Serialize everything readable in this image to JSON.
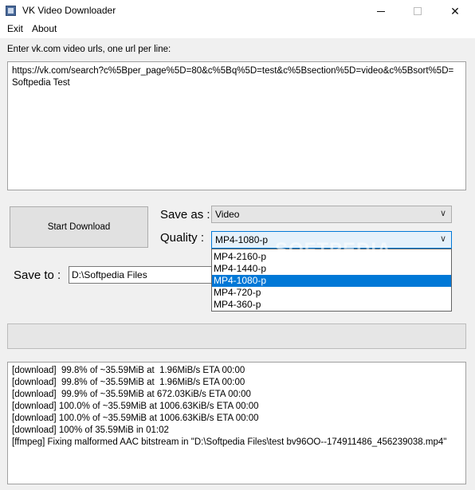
{
  "window": {
    "title": "VK Video Downloader",
    "close_glyph": "✕"
  },
  "menu": {
    "exit": "Exit",
    "about": "About"
  },
  "url_prompt": "Enter vk.com video urls, one url per line:",
  "urls": [
    "https://vk.com/search?c%5Bper_page%5D=80&c%5Bq%5D=test&c%5Bsection%5D=video&c%5Bsort%5D=",
    "Softpedia Test"
  ],
  "start_button": "Start Download",
  "save_as": {
    "label": "Save as :",
    "value": "Video"
  },
  "quality": {
    "label": "Quality :",
    "value": "MP4-1080-p",
    "options": [
      "MP4-2160-p",
      "MP4-1440-p",
      "MP4-1080-p",
      "MP4-720-p",
      "MP4-360-p"
    ],
    "selected_index": 2
  },
  "save_to": {
    "label": "Save to :",
    "value": "D:\\Softpedia Files"
  },
  "progress": {
    "fraction": 0
  },
  "log_lines": [
    "[download]  99.8% of ~35.59MiB at  1.96MiB/s ETA 00:00",
    "[download]  99.8% of ~35.59MiB at  1.96MiB/s ETA 00:00",
    "[download]  99.9% of ~35.59MiB at 672.03KiB/s ETA 00:00",
    "[download] 100.0% of ~35.59MiB at 1006.63KiB/s ETA 00:00",
    "[download] 100.0% of ~35.59MiB at 1006.63KiB/s ETA 00:00",
    "[download] 100% of 35.59MiB in 01:02",
    "[ffmpeg] Fixing malformed AAC bitstream in \"D:\\Softpedia Files\\test bv96OO--174911486_456239038.mp4\""
  ],
  "watermark": "SOFTPEDIA",
  "icons": {
    "app": "app-icon",
    "minimize": "minimize-icon",
    "maximize": "maximize-icon",
    "close": "close-icon",
    "dropdown": "chevron-down-icon"
  },
  "colors": {
    "selection": "#0078d7",
    "window_bg": "#f0f0f0"
  }
}
